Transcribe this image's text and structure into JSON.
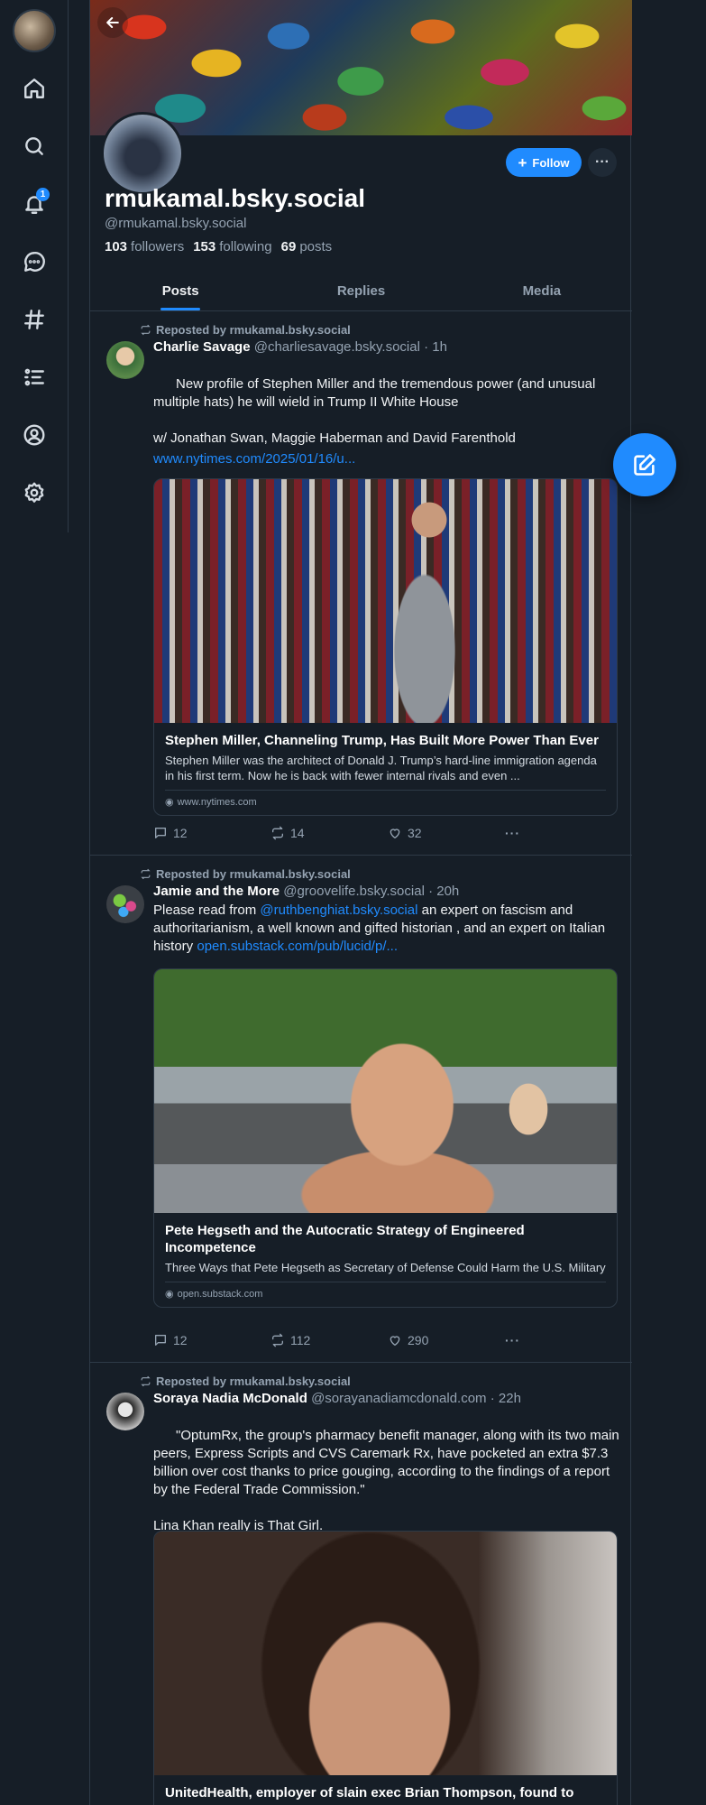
{
  "profile": {
    "display_name": "rmukamal.bsky.social",
    "handle": "@rmukamal.bsky.social",
    "followers_count": "103",
    "followers_label": "followers",
    "following_count": "153",
    "following_label": "following",
    "posts_count": "69",
    "posts_label": "posts",
    "follow_label": "Follow",
    "more_label": "···"
  },
  "nav": {
    "notification_count": "1",
    "icons": [
      "home-icon",
      "search-icon",
      "bell-icon",
      "chat-icon",
      "hashtag-icon",
      "list-icon",
      "profile-icon",
      "gear-icon"
    ]
  },
  "tabs": [
    {
      "label": "Posts",
      "active": true
    },
    {
      "label": "Replies",
      "active": false
    },
    {
      "label": "Media",
      "active": false
    }
  ],
  "posts": [
    {
      "repost_label": "Reposted by rmukamal.bsky.social",
      "author_name": "Charlie Savage",
      "author_meta": "@charliesavage.bsky.social · 1h",
      "text": "New profile of Stephen Miller and the tremendous power (and unusual multiple hats) he will wield in Trump II White House\n\nw/ Jonathan Swan, Maggie Haberman and David Farenthold",
      "link": "www.nytimes.com/2025/01/16/u...",
      "embed_title": "Stephen Miller, Channeling Trump, Has Built More Power Than Ever",
      "embed_desc": "Stephen Miller was the architect of Donald J. Trump’s hard-line immigration agenda in his first term. Now he is back with fewer internal rivals and even ...",
      "embed_domain": "www.nytimes.com",
      "replies": "12",
      "reposts": "14",
      "likes": "32"
    },
    {
      "repost_label": "Reposted by rmukamal.bsky.social",
      "author_name": "Jamie and the More",
      "author_meta": "@groovelife.bsky.social · 20h",
      "text_pre": "Please read from ",
      "mention": "@ruthbenghiat.bsky.social",
      "text_mid": " an expert on fascism and authoritarianism, a well known and gifted historian , and an expert on Italian history ",
      "link": "open.substack.com/pub/lucid/p/...",
      "embed_title": "Pete Hegseth and the Autocratic Strategy of Engineered Incompetence",
      "embed_desc": "Three Ways that Pete Hegseth as Secretary of Defense Could Harm the U.S. Military",
      "embed_domain": "open.substack.com",
      "replies": "12",
      "reposts": "112",
      "likes": "290"
    },
    {
      "repost_label": "Reposted by rmukamal.bsky.social",
      "author_name": "Soraya Nadia McDonald",
      "author_meta": "@sorayanadiamcdonald.com · 22h",
      "text": "\"OptumRx, the group's pharmacy benefit manager, along with its two main peers, Express Scripts and CVS Caremark Rx, have pocketed an extra $7.3 billion over cost thanks to price gouging, according to the findings of a report by the Federal Trade Commission.\"\n\nLina Khan really is That Girl.",
      "embed_title": "UnitedHealth, employer of slain exec Brian Thompson, found to"
    }
  ]
}
